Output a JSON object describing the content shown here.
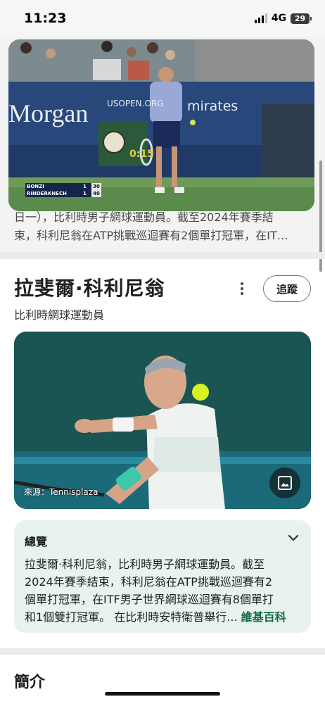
{
  "status_bar": {
    "time": "11:23",
    "network": "4G",
    "battery": "29"
  },
  "video": {
    "sponsor_text": "Morgan",
    "sponsor_right": "mirates",
    "site_banner": "USOPEN.ORG",
    "clock_time": "0:15",
    "scoreboard": [
      {
        "player": "BONZI",
        "set": "1",
        "game": "30"
      },
      {
        "player": "RINDERKNECH",
        "set": "1",
        "game": "40"
      }
    ]
  },
  "previous_snippet": {
    "line1": "日一），比利時男子網球運動員。截至2024年賽季結",
    "line2": "束，科利尼翁在ATP挑戰巡迴賽有2個單打冠軍，在IT…"
  },
  "entity": {
    "title": "拉斐爾·科利尼翁",
    "subtitle": "比利時網球運動員",
    "follow_label": "追蹤",
    "image_source": "來源：Tennisplaza"
  },
  "overview": {
    "title": "總覽",
    "lines": [
      "拉斐爾·科利尼翁，比利時男子網球運動員。截至",
      "2024年賽季結束，科利尼翁在ATP挑戰巡迴賽有2",
      "個單打冠軍，在ITF男子世界網球巡迴賽有8個單打",
      "和1個雙打冠軍。 在比利時安特衛普舉行..."
    ],
    "link": "維基百科"
  },
  "section_intro": "簡介",
  "colors": {
    "overview_bg": "#e8f3ee",
    "link": "#146c43",
    "court_teal": "#1d5b5a"
  }
}
